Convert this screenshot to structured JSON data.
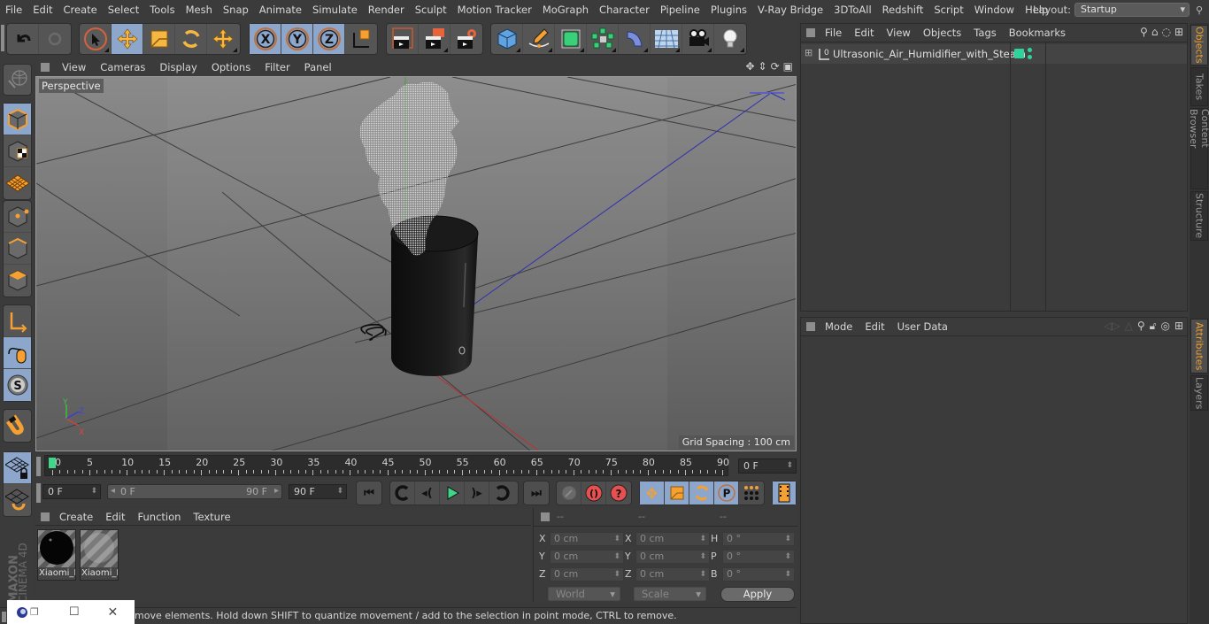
{
  "menubar": {
    "items": [
      "File",
      "Edit",
      "Create",
      "Select",
      "Tools",
      "Mesh",
      "Snap",
      "Animate",
      "Simulate",
      "Render",
      "Sculpt",
      "Motion Tracker",
      "MoGraph",
      "Character",
      "Pipeline",
      "Plugins",
      "V-Ray Bridge",
      "3DToAll",
      "Redshift",
      "Script",
      "Window",
      "Help"
    ],
    "layout_label": "Layout:",
    "layout_value": "Startup"
  },
  "toolbar": {
    "undo": "undo-icon",
    "redo": "redo-icon",
    "tools": [
      "live-selection",
      "move",
      "scale",
      "rotate",
      "last-tool"
    ],
    "axis": [
      "X",
      "Y",
      "Z"
    ],
    "coord_system": "world-coordinate-system",
    "render": [
      "render-view",
      "render-to-picture-viewer",
      "render-settings"
    ],
    "create": [
      "cube",
      "pen-spline",
      "subdivision-surface",
      "cloner",
      "deformer",
      "floor",
      "camera",
      "light"
    ]
  },
  "left_tools": [
    "make-editable",
    "model-mode",
    "texture-mode",
    "workplane-mode",
    "points-mode",
    "edges-mode",
    "polygons-mode",
    "axis-mode",
    "tweak-mode",
    "solo-mode",
    "snap",
    "workplane-lock",
    "workplane-rotate"
  ],
  "viewport": {
    "menu": [
      "View",
      "Cameras",
      "Display",
      "Options",
      "Filter",
      "Panel"
    ],
    "camera_label": "Perspective",
    "grid_spacing": "Grid Spacing : 100 cm",
    "axis_labels": {
      "x": "X",
      "y": "Y",
      "z": "Z"
    }
  },
  "timeline": {
    "ticks": [
      "0",
      "5",
      "10",
      "15",
      "20",
      "25",
      "30",
      "35",
      "40",
      "45",
      "50",
      "55",
      "60",
      "65",
      "70",
      "75",
      "80",
      "85",
      "90"
    ],
    "current_frame": "0 F",
    "current_marker": 0
  },
  "playback": {
    "start_field": "0 F",
    "range_start": "0 F",
    "range_end": "90 F",
    "end_field": "90 F"
  },
  "materials": {
    "menu": [
      "Create",
      "Edit",
      "Function",
      "Texture"
    ],
    "items": [
      {
        "name": "Xiaomi_I",
        "type": "black-glossy"
      },
      {
        "name": "Xiaomi_I",
        "type": "translucent"
      }
    ]
  },
  "coordinates": {
    "headers": [
      "--",
      "--",
      "--"
    ],
    "position": [
      {
        "axis": "X",
        "value": "0 cm"
      },
      {
        "axis": "Y",
        "value": "0 cm"
      },
      {
        "axis": "Z",
        "value": "0 cm"
      }
    ],
    "size": [
      {
        "axis": "X",
        "value": "0 cm"
      },
      {
        "axis": "Y",
        "value": "0 cm"
      },
      {
        "axis": "Z",
        "value": "0 cm"
      }
    ],
    "rotation": [
      {
        "axis": "H",
        "value": "0 °"
      },
      {
        "axis": "P",
        "value": "0 °"
      },
      {
        "axis": "B",
        "value": "0 °"
      }
    ],
    "mode_select": "World",
    "type_select": "Scale",
    "apply_label": "Apply"
  },
  "status": {
    "text": "move elements. Hold down SHIFT to quantize movement / add to the selection in point mode, CTRL to remove."
  },
  "objects_panel": {
    "menu": [
      "File",
      "Edit",
      "View",
      "Objects",
      "Tags",
      "Bookmarks"
    ],
    "objects": [
      {
        "name": "Ultrasonic_Air_Humidifier_with_Steam",
        "layer_color": "#2ed39a"
      }
    ]
  },
  "attributes_panel": {
    "menu": [
      "Mode",
      "Edit",
      "User Data"
    ]
  },
  "side_tabs": {
    "top": [
      "Objects",
      "Takes",
      "Content Browser",
      "Structure"
    ],
    "bottom": [
      "Attributes",
      "Layers"
    ]
  },
  "brand": {
    "text1": "MAXON",
    "text2": "CINEMA 4D"
  },
  "colors": {
    "accent": "#f0a030",
    "selected": "#8ca6cc",
    "layer": "#2ed39a"
  }
}
